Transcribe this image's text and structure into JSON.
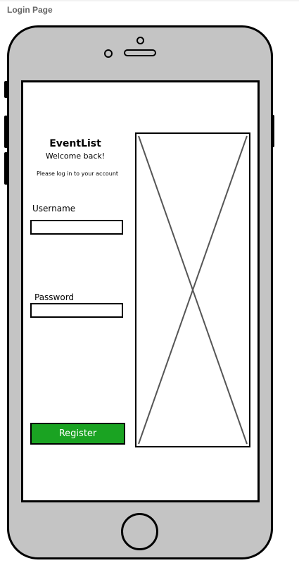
{
  "page_label": "Login Page",
  "app": {
    "title": "EventList",
    "welcome": "Welcome back!",
    "instruction": "Please log in to your account"
  },
  "form": {
    "username_label": "Username",
    "username_value": "",
    "password_label": "Password",
    "password_value": "",
    "register_label": "Register"
  },
  "colors": {
    "device_body": "#c4c4c4",
    "register_button": "#1aa322",
    "outline": "#000000",
    "placeholder_cross": "#555555"
  },
  "icons": {
    "image_placeholder": "image-placeholder-icon"
  }
}
